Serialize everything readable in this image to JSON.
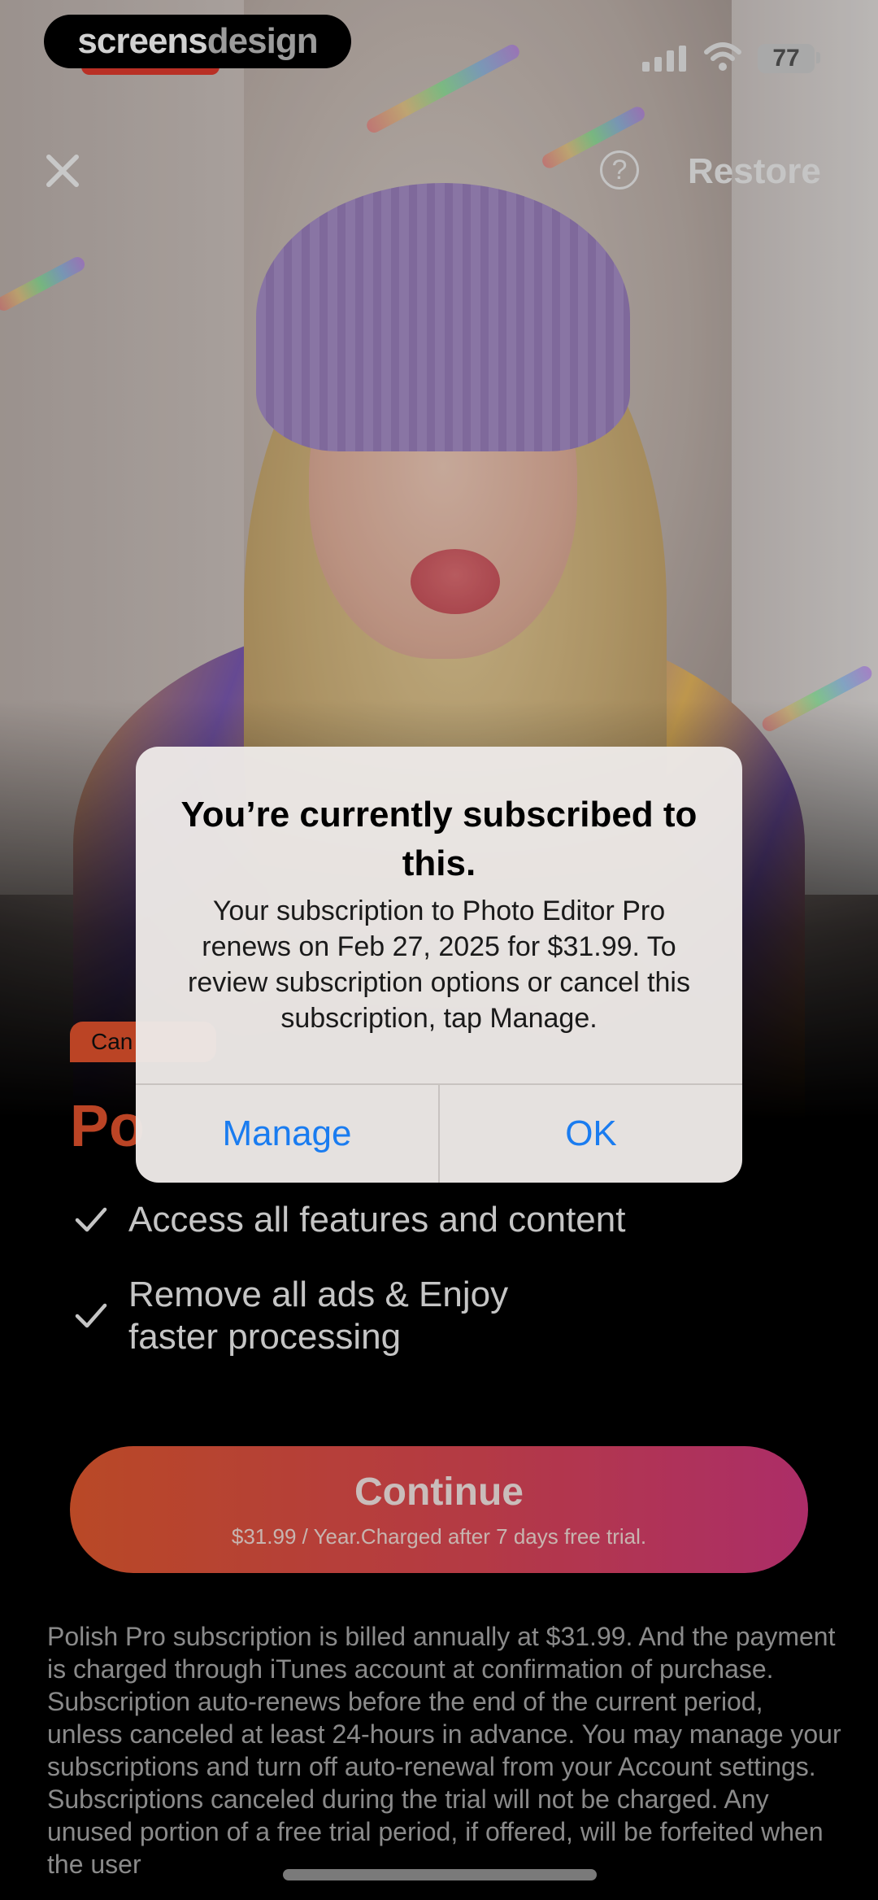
{
  "status_bar": {
    "battery": "77"
  },
  "brand": {
    "part1": "screens",
    "part2": "design"
  },
  "header": {
    "close_icon": "close-icon",
    "help_label": "?",
    "restore_label": "Restore"
  },
  "paywall": {
    "badge_label": "Can",
    "title": "Po",
    "features": [
      "Access all features and content",
      "Remove all ads & Enjoy faster processing"
    ],
    "cta_label": "Continue",
    "cta_subtitle": "$31.99 / Year.Charged after 7 days free trial.",
    "legal_text": "Polish Pro subscription is billed annually at $31.99. And the payment is charged through iTunes account at confirmation of purchase. Subscription auto-renews before the end of the current period, unless canceled at least 24-hours in advance. You may manage your subscriptions and turn off auto-renewal from your Account settings. Subscriptions canceled during the trial will not be charged. Any unused portion of a free trial period, if offered, will be forfeited when the user"
  },
  "alert": {
    "title": "You’re currently subscribed to this.",
    "message": "Your subscription to Photo Editor Pro renews on Feb 27, 2025 for $31.99. To review subscription options or cancel this subscription, tap Manage.",
    "manage_label": "Manage",
    "ok_label": "OK"
  },
  "colors": {
    "accent": "#e4532e",
    "cta_start": "#e2592f",
    "cta_end": "#d2387f",
    "alert_button": "#1a7cf0"
  }
}
